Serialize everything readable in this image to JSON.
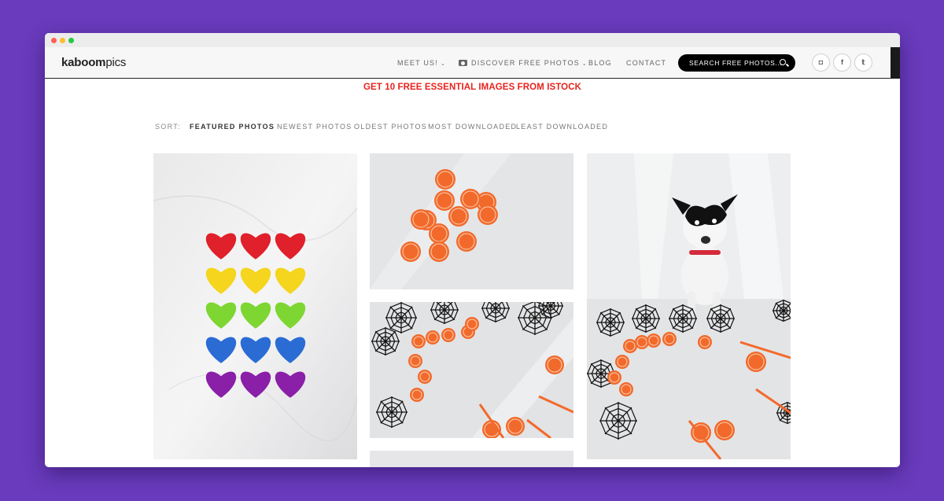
{
  "brand": {
    "logo_bold": "kaboom",
    "logo_light": "pics"
  },
  "nav": {
    "items": [
      {
        "label": "MEET US!",
        "dropdown": true
      },
      {
        "label": "DISCOVER FREE PHOTOS",
        "dropdown": true,
        "icon": "camera-icon"
      },
      {
        "label": "BLOG",
        "dropdown": false
      },
      {
        "label": "CONTACT",
        "dropdown": false
      }
    ],
    "chevron": "⌄",
    "search_label": "SEARCH FREE PHOTOS...",
    "social": [
      {
        "name": "instagram-icon",
        "glyph": "◘"
      },
      {
        "name": "facebook-icon",
        "glyph": "f"
      },
      {
        "name": "twitter-icon",
        "glyph": "𝕥"
      }
    ]
  },
  "promo": {
    "text": "GET 10 FREE ESSENTIAL IMAGES FROM ISTOCK",
    "color": "#e8231e"
  },
  "sort": {
    "label": "SORT:",
    "options": [
      {
        "label": "FEATURED PHOTOS",
        "active": true
      },
      {
        "label": "NEWEST PHOTOS",
        "active": false
      },
      {
        "label": "OLDEST PHOTOS",
        "active": false
      },
      {
        "label": "MOST DOWNLOADED",
        "active": false
      },
      {
        "label": "LEAST DOWNLOADED",
        "active": false
      }
    ]
  },
  "gallery": {
    "photos": [
      {
        "subject": "rainbow glitter hearts on marble"
      },
      {
        "subject": "halloween pumpkin badges"
      },
      {
        "subject": "halloween spider webs and straws"
      },
      {
        "subject": "dog with halloween decorations"
      }
    ]
  },
  "colors": {
    "background": "#6a3bbd",
    "accent_black": "#000000",
    "pumpkin": "#f26a2b"
  }
}
